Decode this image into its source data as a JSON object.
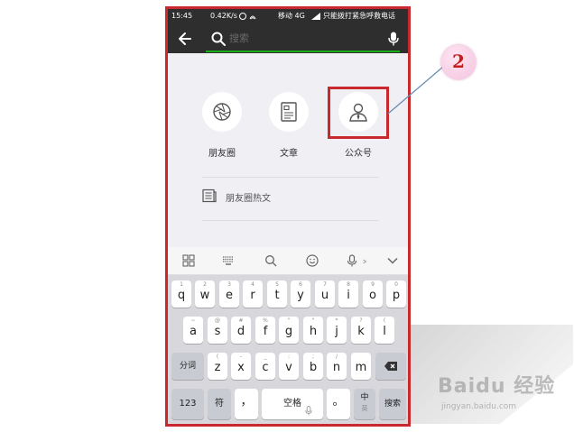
{
  "status_bar": {
    "time": "15:45",
    "speed": "0.42K/s",
    "carrier": "移动 4G",
    "notice": "只能拨打紧急呼救电话"
  },
  "search": {
    "placeholder": "搜索"
  },
  "categories": [
    {
      "label": "朋友圈",
      "icon": "aperture-icon"
    },
    {
      "label": "文章",
      "icon": "article-icon"
    },
    {
      "label": "公众号",
      "icon": "official-account-icon"
    }
  ],
  "hot_articles": {
    "label": "朋友圈热文",
    "icon": "newspaper-icon"
  },
  "toolbar": {
    "icons": [
      "grid-icon",
      "keyboard-icon",
      "search-icon",
      "emoji-icon",
      "voice-icon",
      "collapse-icon"
    ]
  },
  "keyboard": {
    "row1": [
      {
        "num": "1",
        "key": "q"
      },
      {
        "num": "2",
        "key": "w"
      },
      {
        "num": "3",
        "key": "e"
      },
      {
        "num": "4",
        "key": "r"
      },
      {
        "num": "5",
        "key": "t"
      },
      {
        "num": "6",
        "key": "y"
      },
      {
        "num": "7",
        "key": "u"
      },
      {
        "num": "8",
        "key": "i"
      },
      {
        "num": "9",
        "key": "o"
      },
      {
        "num": "0",
        "key": "p"
      }
    ],
    "row2": [
      {
        "num": "~",
        "key": "a"
      },
      {
        "num": "@",
        "key": "s"
      },
      {
        "num": "#",
        "key": "d"
      },
      {
        "num": "%",
        "key": "f"
      },
      {
        "num": "\"",
        "key": "g"
      },
      {
        "num": "\"",
        "key": "h"
      },
      {
        "num": "*",
        "key": "j"
      },
      {
        "num": "?",
        "key": "k"
      },
      {
        "num": "(",
        "key": "l"
      }
    ],
    "row3": [
      {
        "num": "(",
        "key": "z"
      },
      {
        "num": "-",
        "key": "x"
      },
      {
        "num": "_",
        "key": "c"
      },
      {
        "num": ":",
        "key": "v"
      },
      {
        "num": ";",
        "key": "b"
      },
      {
        "num": "/",
        "key": "n"
      },
      {
        "num": "",
        "key": "m"
      }
    ],
    "fenci": "分词",
    "k123": "123",
    "fu": "符",
    "comma": "，",
    "space": "空格",
    "period": "。",
    "lang": "中",
    "lang_sub": "英",
    "search": "搜索"
  },
  "annotation": {
    "number": "2"
  },
  "watermark": {
    "brand": "Baidu 经验",
    "url": "jingyan.baidu.com"
  },
  "colors": {
    "highlight": "#c9282d",
    "accent_green": "#1aad19",
    "bar_dark": "#2e2e2e"
  }
}
